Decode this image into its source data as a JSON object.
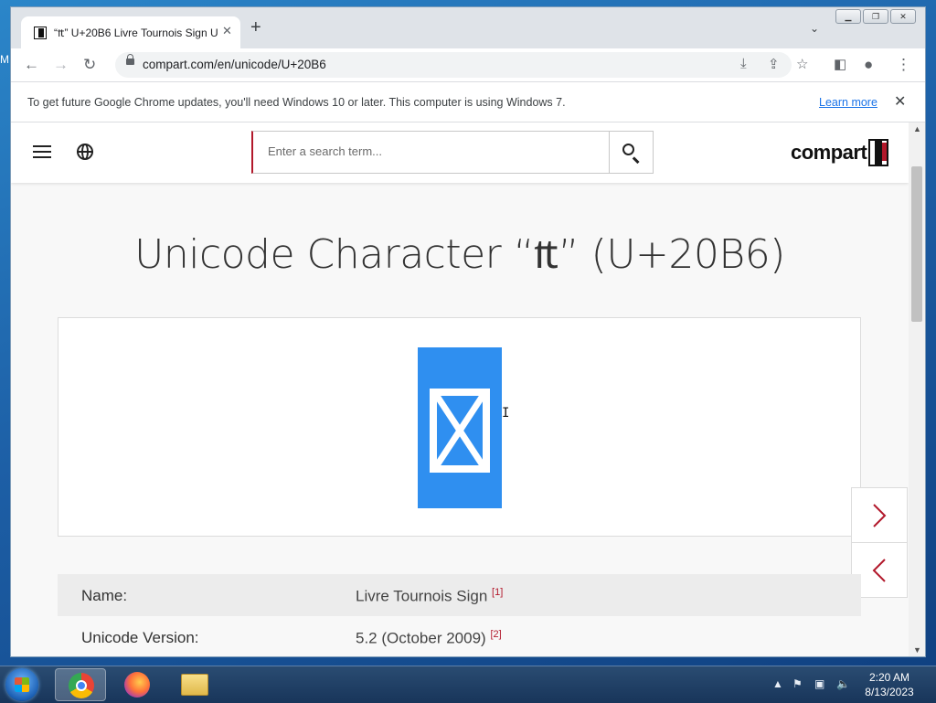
{
  "desktop": {
    "edge_label": "M"
  },
  "browser": {
    "tab": {
      "title": "“₶” U+20B6 Livre Tournois Sign U"
    },
    "toolbar": {
      "url": "compart.com/en/unicode/U+20B6"
    },
    "infobar": {
      "message": "To get future Google Chrome updates, you'll need Windows 10 or later. This computer is using Windows 7.",
      "link": "Learn more"
    }
  },
  "site": {
    "search": {
      "placeholder": "Enter a search term..."
    },
    "logo_text": "compart",
    "page_title": "Unicode Character “₶” (U+20B6)",
    "glyph_color": "#2f8ff0",
    "accent_color": "#b2182b",
    "table": [
      {
        "label": "Name:",
        "value": "Livre Tournois Sign",
        "ref": "[1]"
      },
      {
        "label": "Unicode Version:",
        "value": "5.2 (October 2009)",
        "ref": "[2]"
      }
    ]
  },
  "taskbar": {
    "apps": [
      "chrome-icon",
      "firefox-icon",
      "file-explorer-icon"
    ],
    "clock": {
      "time": "2:20 AM",
      "date": "8/13/2023"
    }
  }
}
